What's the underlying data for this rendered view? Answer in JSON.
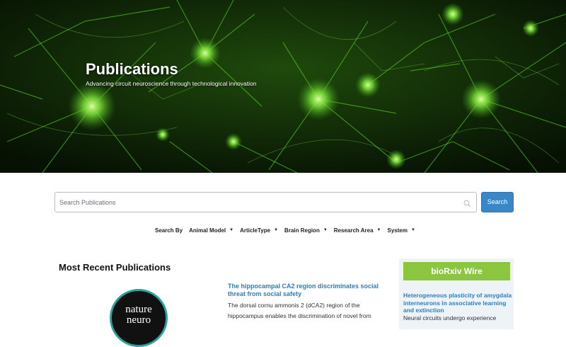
{
  "hero": {
    "title": "Publications",
    "subtitle": "Advancing circuit neuroscience through technological innovation"
  },
  "search": {
    "placeholder": "Search Publications",
    "button_label": "Search"
  },
  "filters": {
    "label": "Search By",
    "items": [
      {
        "label": "Animal Model"
      },
      {
        "label": "ArticleType"
      },
      {
        "label": "Brain Region"
      },
      {
        "label": "Research Area"
      },
      {
        "label": "System"
      }
    ]
  },
  "recent": {
    "heading": "Most Recent Publications",
    "journal_logo_text": [
      "nature",
      "neuro"
    ],
    "article": {
      "title": "The hippocampal CA2 region discriminates social threat from social safety",
      "abstract": "The dorsal cornu ammonis 2 (dCA2) region of the hippocampus enables the discrimination of novel from"
    }
  },
  "sidebar": {
    "banner": "bioRxiv Wire",
    "item_title": "Heterogeneous plasticity of amygdala interneurons in associative learning and extinction",
    "item_body": "Neural circuits undergo experience"
  },
  "colors": {
    "accent_blue": "#3a87c8",
    "link_blue": "#2f7fb8",
    "wire_green": "#8cc63f",
    "journal_ring": "#2aa39b"
  },
  "icons": {
    "search_field": "search-icon",
    "filter_caret": "caret-down-icon"
  }
}
